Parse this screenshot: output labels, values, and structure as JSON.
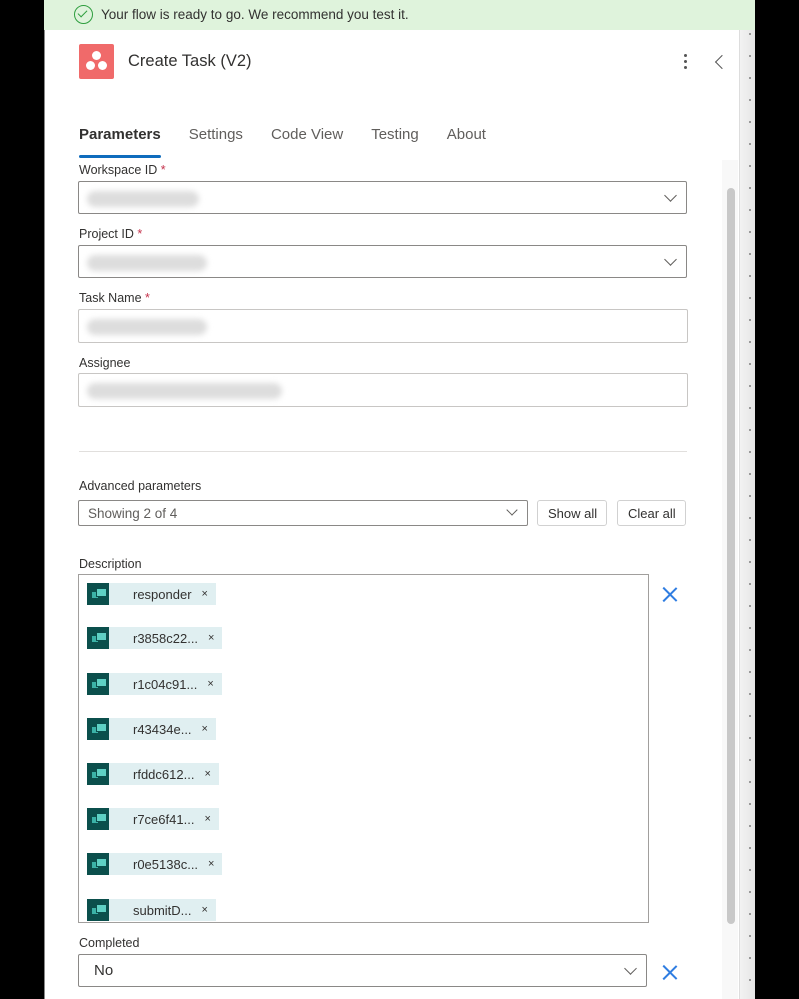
{
  "banner": {
    "icon": "check-circle-icon",
    "text": "Your flow is ready to go. We recommend you test it.",
    "color": "#dff3dc"
  },
  "header": {
    "icon": "asana-logo-icon",
    "title": "Create Task (V2)",
    "more_icon": "more-vertical-icon",
    "back_icon": "chevron-left-icon",
    "brand_color": "#f06a6a"
  },
  "tabs": [
    {
      "label": "Parameters",
      "active": true
    },
    {
      "label": "Settings",
      "active": false
    },
    {
      "label": "Code View",
      "active": false
    },
    {
      "label": "Testing",
      "active": false
    },
    {
      "label": "About",
      "active": false
    }
  ],
  "fields": {
    "workspace": {
      "label": "Workspace ID",
      "required": "*",
      "value": "[redacted]"
    },
    "project": {
      "label": "Project ID",
      "required": "*",
      "value": "[redacted]"
    },
    "task_name": {
      "label": "Task Name",
      "required": "*",
      "value": "[redacted]"
    },
    "assignee": {
      "label": "Assignee",
      "value": "[redacted]"
    }
  },
  "advanced": {
    "label": "Advanced parameters",
    "selected": "Showing 2 of 4",
    "show_all": "Show all",
    "clear_all": "Clear all"
  },
  "description": {
    "label": "Description",
    "tokens": [
      {
        "text": "responder"
      },
      {
        "text": "r3858c22..."
      },
      {
        "text": "r1c04c91..."
      },
      {
        "text": "r43434e..."
      },
      {
        "text": "rfddc612..."
      },
      {
        "text": "r7ce6f41..."
      },
      {
        "text": "r0e5138c..."
      },
      {
        "text": "submitD..."
      }
    ],
    "token_remove": "×"
  },
  "completed": {
    "label": "Completed",
    "value": "No"
  },
  "accent_color": "#0f6cbd",
  "remove_color": "#2f7de1"
}
